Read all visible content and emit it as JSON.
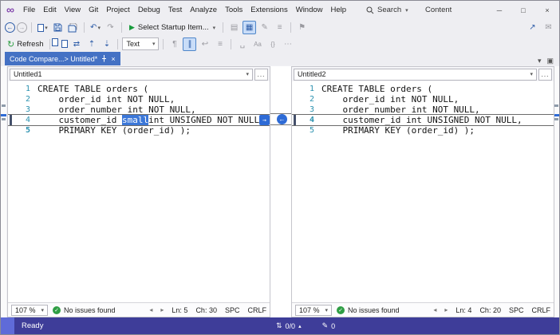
{
  "titlebar": {
    "menus": [
      "File",
      "Edit",
      "View",
      "Git",
      "Project",
      "Debug",
      "Test",
      "Analyze",
      "Tools",
      "Extensions",
      "Window",
      "Help"
    ],
    "search": "Search",
    "content": "Content"
  },
  "toolbar_main": {
    "startup_item": "Select Startup Item..."
  },
  "toolbar_compare": {
    "refresh": "Refresh",
    "mode": "Text"
  },
  "tab": {
    "title": "Code Compare...> Untitled*"
  },
  "icons": {
    "logo": "∞",
    "back": "←",
    "forward": "→",
    "caret": "▾",
    "undo": "↶",
    "redo": "↷",
    "play": "▶",
    "minimize": "─",
    "maximize": "□",
    "close": "×",
    "refresh": "↻",
    "swap": "⇄",
    "prev": "⇡",
    "next": "⇣",
    "pilcrow": "¶",
    "bars": "∥",
    "wrap": "↩",
    "lines": "≡",
    "space": "␣",
    "case": "Aa",
    "braces": "{}",
    "more": "⋯",
    "grid1": "▤",
    "grid2": "▦",
    "pencil": "✎",
    "flag": "⚑",
    "share": "↗",
    "mail": "✉",
    "check": "✓",
    "browse": "...",
    "sb_left": "◂",
    "sb_right": "▸",
    "updown": "⇅",
    "collapse": "▴",
    "chev_down": "▾",
    "float": "▣",
    "arrow_r": "→",
    "arrow_l": "←",
    "tab_close": "×"
  },
  "left_pane": {
    "title": "Untitled1",
    "lines": [
      {
        "n": "1",
        "text": "CREATE TABLE orders ("
      },
      {
        "n": "2",
        "text": "    order_id int NOT NULL,"
      },
      {
        "n": "3",
        "text": "    order_number int NOT NULL,"
      },
      {
        "n": "4",
        "pre": "    customer_id ",
        "sel": "small",
        "post": "int UNSIGNED NOT NULL,"
      },
      {
        "n": "5",
        "text": "    PRIMARY KEY (order_id) );"
      }
    ],
    "zoom": "107 %",
    "issues": "No issues found",
    "ln": "Ln: 5",
    "ch": "Ch: 30",
    "spc": "SPC",
    "eol": "CRLF"
  },
  "right_pane": {
    "title": "Untitled2",
    "lines": [
      {
        "n": "1",
        "text": "CREATE TABLE orders ("
      },
      {
        "n": "2",
        "text": "    order_id int NOT NULL,"
      },
      {
        "n": "3",
        "text": "    order_number int NOT NULL,"
      },
      {
        "n": "4",
        "text": "    customer_id int UNSIGNED NOT NULL,"
      },
      {
        "n": "5",
        "text": "    PRIMARY KEY (order_id) );"
      }
    ],
    "zoom": "107 %",
    "issues": "No issues found",
    "ln": "Ln: 4",
    "ch": "Ch: 20",
    "spc": "SPC",
    "eol": "CRLF"
  },
  "statusbar": {
    "ready": "Ready",
    "diff": "0/0",
    "edits": "0"
  }
}
